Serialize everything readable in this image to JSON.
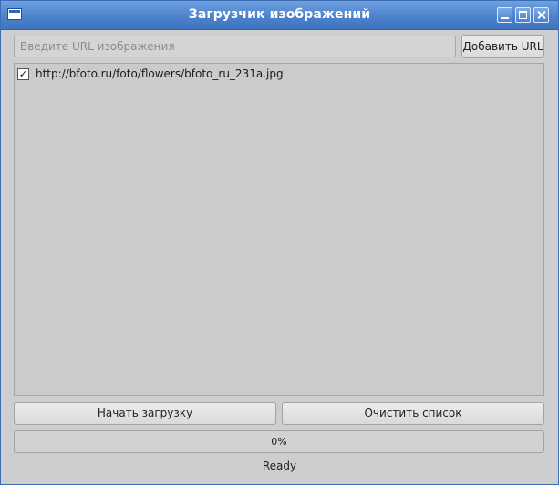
{
  "window": {
    "title": "Загрузчик изображений"
  },
  "url_bar": {
    "placeholder": "Введите URL изображения",
    "value": "",
    "add_button_label": "Добавить URL"
  },
  "url_list": {
    "items": [
      {
        "checked": true,
        "check_glyph": "✓",
        "label": "http://bfoto.ru/foto/flowers/bfoto_ru_231a.jpg"
      }
    ]
  },
  "actions": {
    "start_label": "Начать загрузку",
    "clear_label": "Очистить список"
  },
  "progress": {
    "value": 0,
    "text": "0%"
  },
  "status": {
    "text": "Ready"
  },
  "colors": {
    "titlebar": "#4d82cc",
    "window_bg": "#cecece"
  },
  "icons": {
    "app": "app-window-icon",
    "minimize": "minimize-icon",
    "maximize": "maximize-icon",
    "close": "close-icon"
  }
}
